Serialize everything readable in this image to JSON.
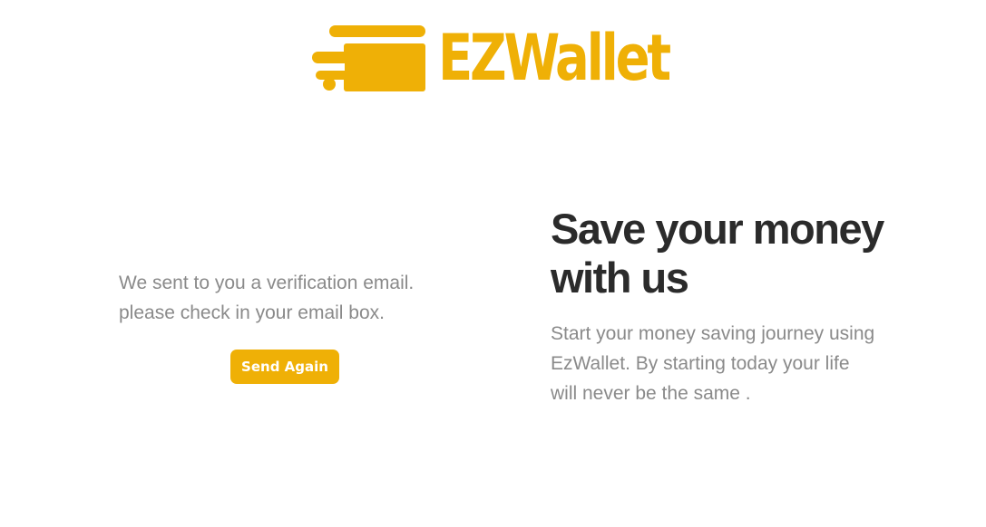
{
  "brand": {
    "name": "EZWallet",
    "color": "#EFB006",
    "logo_icon": "card-speed-icon"
  },
  "verification": {
    "message": "We sent to you a verification email. please check in your email box.",
    "send_again_label": "Send Again"
  },
  "hero": {
    "headline": "Save your money with us",
    "subtext": "Start your money saving journey using EzWallet. By starting today your life will never be the same ."
  },
  "colors": {
    "accent": "#EFB006",
    "heading": "#2b2b2b",
    "body_text": "#8a8a8a",
    "background": "#ffffff"
  }
}
